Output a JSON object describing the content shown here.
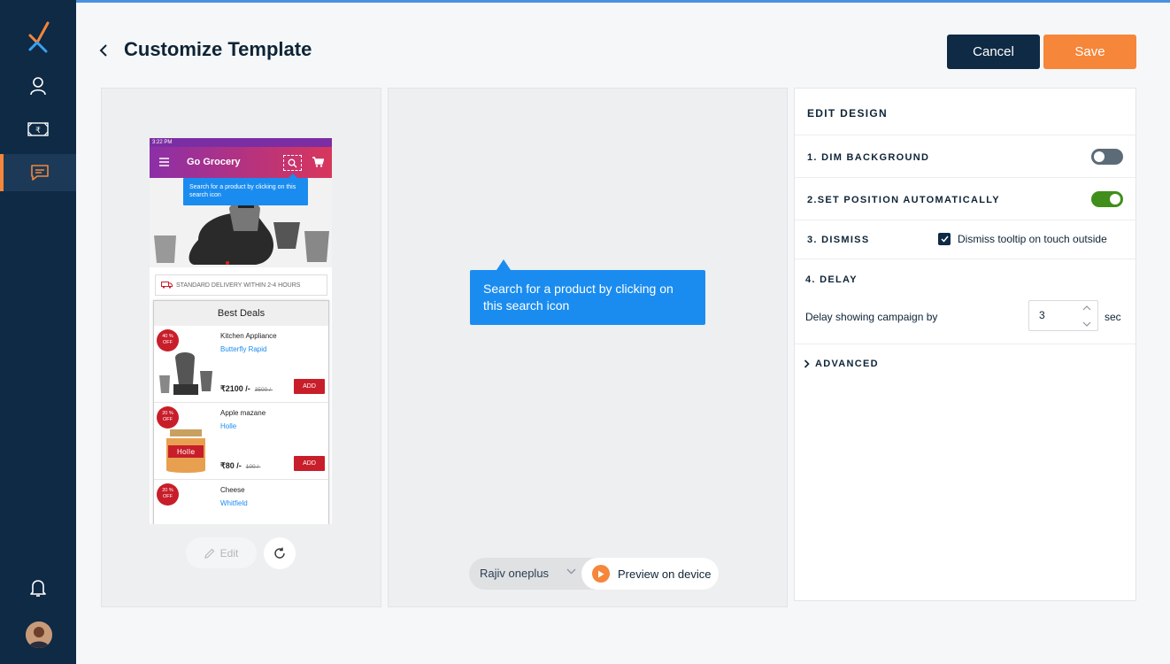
{
  "header": {
    "title": "Customize Template",
    "cancel_label": "Cancel",
    "save_label": "Save"
  },
  "colors": {
    "sidebar": "#0e2a45",
    "accent": "#f5863a",
    "tooltip": "#1a8cf0",
    "toggle_on": "#3f8f1a",
    "toggle_off": "#5c6b78"
  },
  "sidebar": {
    "items": [
      "logo-icon",
      "user-icon",
      "money-icon",
      "message-icon",
      "bell-icon",
      "avatar"
    ]
  },
  "phone": {
    "status_time": "3:22 PM",
    "app_title": "Go Grocery",
    "tooltip": "Search for a product by clicking on this search icon",
    "delivery": "STANDARD DELIVERY WITHIN 2-4 HOURS",
    "deals_title": "Best Deals",
    "products": [
      {
        "badge_pct": "40 %",
        "badge_off": "OFF",
        "name": "Kitchen Appliance",
        "brand": "Butterfly Rapid",
        "price": "₹2100 /-",
        "old_price": "3500 /-",
        "add": "ADD"
      },
      {
        "badge_pct": "20 %",
        "badge_off": "OFF",
        "name": "Apple mazane",
        "brand": "Holle",
        "price": "₹80 /-",
        "old_price": "100 /-",
        "add": "ADD"
      },
      {
        "badge_pct": "20 %",
        "badge_off": "OFF",
        "name": "Cheese",
        "brand": "Whitfield"
      }
    ]
  },
  "preview": {
    "edit_label": "Edit",
    "tooltip_text": "Search for a product by clicking on this search icon",
    "device_name": "Rajiv oneplus",
    "preview_label": "Preview on device"
  },
  "design": {
    "heading": "EDIT DESIGN",
    "dim_label": "1. DIM BACKGROUND",
    "dim_on": false,
    "position_label": "2.SET POSITION AUTOMATICALLY",
    "position_on": true,
    "dismiss_label": "3. DISMISS",
    "dismiss_option": "Dismiss tooltip on touch outside",
    "dismiss_checked": true,
    "delay_label": "4. DELAY",
    "delay_text": "Delay showing campaign by",
    "delay_value": "3",
    "delay_unit": "sec",
    "advanced_label": "ADVANCED"
  }
}
